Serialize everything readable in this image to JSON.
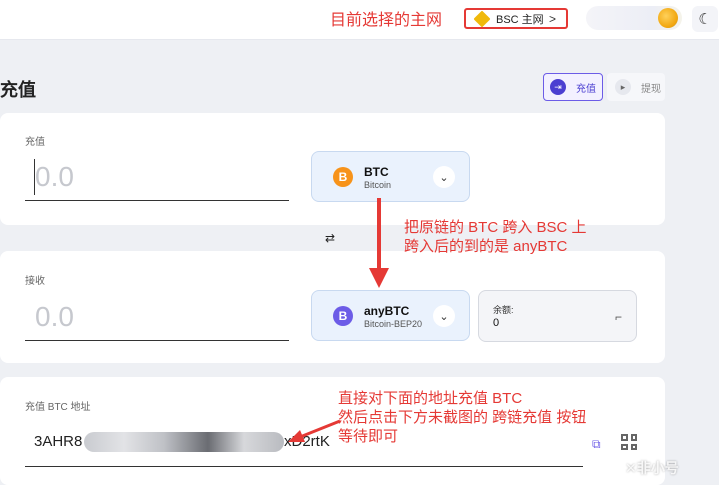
{
  "header": {
    "annotation": "目前选择的主网",
    "network_label": "BSC 主网",
    "network_chevron": ">",
    "theme_icon": "moon-icon"
  },
  "page": {
    "title": "充值",
    "tabs": [
      {
        "label": "充值",
        "active": true
      },
      {
        "label": "提现",
        "active": false
      }
    ]
  },
  "deposit": {
    "label": "充值",
    "amount_placeholder": "0.0",
    "token": {
      "symbol": "BTC",
      "network": "Bitcoin",
      "icon": "B"
    }
  },
  "receive": {
    "label": "接收",
    "amount_placeholder": "0.0",
    "token": {
      "symbol": "anyBTC",
      "network": "Bitcoin-BEP20",
      "icon": "B"
    },
    "balance_label": "余额:",
    "balance_value": "0"
  },
  "address": {
    "label": "充值 BTC 地址",
    "prefix": "3AHR8",
    "suffix": "xD2rtK"
  },
  "annotations": {
    "bridge_line1": "把原链的 BTC 跨入 BSC 上",
    "bridge_line2": "跨入后的到的是 anyBTC",
    "deposit_line1": "直接对下面的地址充值 BTC",
    "deposit_line2": "然后点击下方未截图的 跨链充值 按钮",
    "deposit_line3": "等待即可"
  },
  "watermark": "✕非小号",
  "colors": {
    "accent": "#6c5ce7",
    "annotation": "#e53935",
    "bnb": "#f0b90b",
    "btc": "#f7931a",
    "anybtc": "#6c5ce7"
  }
}
